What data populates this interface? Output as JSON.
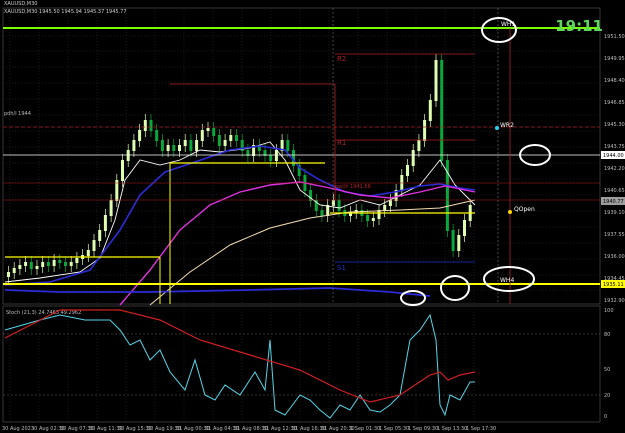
{
  "window": {
    "symbol": "XAUUSD,M30",
    "ohlc": "XAUUSD,M30 1945.50 1945.94 1945.37 1945.77",
    "clock": "19:11"
  },
  "main_price_axis": {
    "ticks": [
      "1951.50",
      "1949.95",
      "1948.40",
      "1946.85",
      "1945.30",
      "1943.75",
      "1942.20",
      "1940.65",
      "1939.10",
      "1937.55",
      "1936.00",
      "1934.45",
      "1932.90"
    ]
  },
  "price_tags": [
    {
      "label": "1944.00",
      "color": "#ffffff",
      "text_color": "#000000"
    },
    {
      "label": "1940.77",
      "color": "#9e9e9e",
      "text_color": "#000000"
    },
    {
      "label": "1935.11",
      "color": "#ffff00",
      "text_color": "#000000"
    }
  ],
  "levels": {
    "wh1": "WH1",
    "wr2": "WR2",
    "qopen": "QOpen",
    "wh4": "WH4",
    "r2": "R2",
    "r1": "R1",
    "s1": "S1",
    "pdhl": "pdh/l 1944",
    "pw": "pwl/h 1941.68"
  },
  "indicator": {
    "label": "Stoch (21,3) 24.7463 49.2962",
    "ticks": [
      "100",
      "80",
      "50",
      "20",
      "0"
    ]
  },
  "time_axis": {
    "ticks": [
      "30 Aug 2023",
      "30 Aug 02:30",
      "30 Aug 07:30",
      "30 Aug 11:30",
      "30 Aug 15:30",
      "30 Aug 19:30",
      "31 Aug 00:30",
      "31 Aug 04:30",
      "31 Aug 08:30",
      "31 Aug 12:30",
      "31 Aug 16:30",
      "31 Aug 20:30",
      "1 Sep 01:30",
      "1 Sep 05:30",
      "1 Sep 09:30",
      "1 Sep 13:30",
      "1 Sep 17:30"
    ]
  },
  "colors": {
    "background": "#000000",
    "bull_candle": "#dfffb0",
    "bear_candle": "#0aa83c",
    "ma_white": "#ffffff",
    "ma_blue": "#2b2bd9",
    "ma_magenta": "#e030e0",
    "ma_beige": "#f5deb3",
    "level_yellow": "#ffff00",
    "level_green": "#7cfc00",
    "level_red": "#b22222",
    "grid": "#3a3a3a",
    "stoch_main": "#53d6e8",
    "stoch_signal": "#d22020"
  }
}
